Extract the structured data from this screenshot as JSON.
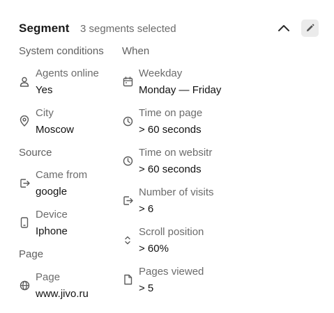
{
  "header": {
    "title": "Segment",
    "subtitle": "3 segments selected",
    "collapse_icon": "chevron-up-icon",
    "edit_icon": "pencil-icon"
  },
  "left": {
    "system_conditions": {
      "title": "System conditions",
      "items": [
        {
          "label": "Agents online",
          "value": "Yes",
          "icon": "user-icon"
        },
        {
          "label": "City",
          "value": "Moscow",
          "icon": "location-pin-icon"
        }
      ]
    },
    "source": {
      "title": "Source",
      "items": [
        {
          "label": "Came from",
          "value": "google",
          "icon": "enter-icon"
        },
        {
          "label": "Device",
          "value": "Iphone",
          "icon": "phone-icon"
        }
      ]
    },
    "page": {
      "title": "Page",
      "items": [
        {
          "label": "Page",
          "value": "www.jivo.ru",
          "icon": "globe-icon"
        }
      ]
    }
  },
  "right": {
    "when": {
      "title": "When",
      "items": [
        {
          "label": "Weekday",
          "value": "Monday — Friday",
          "icon": "calendar-icon"
        },
        {
          "label": "Time on page",
          "value": "> 60 seconds",
          "icon": "clock-icon"
        },
        {
          "label": "Time on websitr",
          "value": "> 60 seconds",
          "icon": "clock-icon"
        },
        {
          "label": "Number of visits",
          "value": "> 6",
          "icon": "enter-icon"
        },
        {
          "label": "Scroll position",
          "value": "> 60%",
          "icon": "scroll-icon"
        },
        {
          "label": "Pages viewed",
          "value": "> 5",
          "icon": "page-icon"
        }
      ]
    }
  },
  "colors": {
    "text_primary": "#111111",
    "text_secondary": "#6b6b6b",
    "icon": "#5a5a5a",
    "edit_button_bg": "#ebebeb"
  }
}
